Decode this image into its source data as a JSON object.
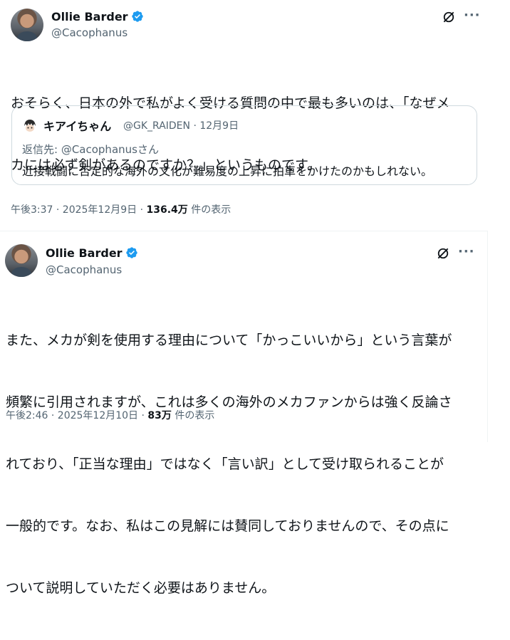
{
  "tweet1": {
    "author_name": "Ollie Barder",
    "author_handle": "@Cacophanus",
    "more_label": "···",
    "text_line1": "おそらく、日本の外で私がよく受ける質問の中で最も多いのは、「なぜメ",
    "text_line2": "カには必ず剣があるのですか？」というものです。",
    "quote": {
      "author_name": "キアイちゃん",
      "author_handle": "@GK_RAIDEN",
      "date": "12月9日",
      "reply_to": "返信先: @Cacophanusさん",
      "text": "近接戦闘に否定的な海外の文化が難易度の上昇に拍車をかけたのかもしれない。"
    },
    "time": "午後3:37 · 2025年12月9日 · ",
    "views_count": "136.4万",
    "views_suffix": " 件の表示"
  },
  "tweet2": {
    "author_name": "Ollie Barder",
    "author_handle": "@Cacophanus",
    "more_label": "···",
    "text_line1": "また、メカが剣を使用する理由について「かっこいいから」という言葉が",
    "text_line2": "頻繁に引用されますが、これは多くの海外のメカファンからは強く反論さ",
    "text_line3": "れており、「正当な理由」ではなく「言い訳」として受け取られることが",
    "text_line4": "一般的です。なお、私はこの見解には賛同しておりませんので、その点に",
    "text_line5": "ついて説明していただく必要はありません。",
    "time": "午後2:46 · 2025年12月10日 · ",
    "views_count": "83万",
    "views_suffix": " 件の表示"
  },
  "icons": {
    "verified": "verified-badge-icon",
    "grok": "grok-icon",
    "more": "more-icon"
  },
  "colors": {
    "verified_blue": "#1d9bf0",
    "secondary_text": "#536471",
    "primary_text": "#0f1419",
    "border": "#cfd9de"
  }
}
